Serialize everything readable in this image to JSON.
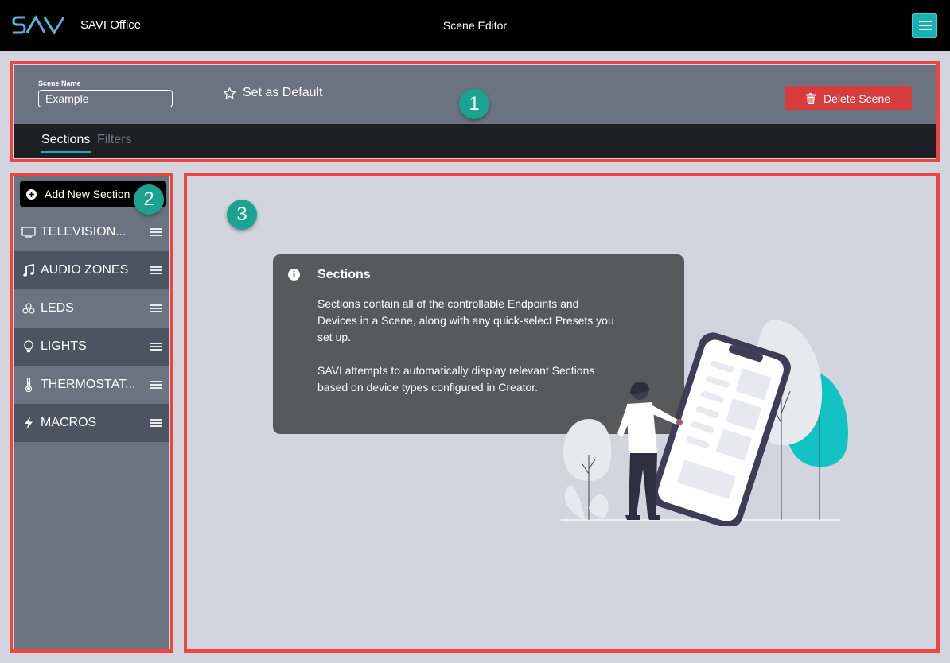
{
  "topbar": {
    "logo_text": "SAVI",
    "app_name": "SAVI Office",
    "page_title": "Scene Editor",
    "menu_icon": "hamburger-icon",
    "accent_color": "#17b1b5"
  },
  "scene": {
    "name_label": "Scene Name",
    "name_value": "Example",
    "set_default_label": "Set as Default",
    "delete_label": "Delete Scene",
    "delete_color": "#d63c3c"
  },
  "tabs": [
    {
      "label": "Sections",
      "active": true
    },
    {
      "label": "Filters",
      "active": false
    }
  ],
  "sidebar": {
    "add_label": "Add New Section",
    "items": [
      {
        "label": "TELEVISION...",
        "icon": "television-icon"
      },
      {
        "label": "AUDIO ZONES",
        "icon": "music-note-icon"
      },
      {
        "label": "LEDS",
        "icon": "leds-icon"
      },
      {
        "label": "LIGHTS",
        "icon": "lightbulb-icon"
      },
      {
        "label": "THERMOSTAT...",
        "icon": "thermometer-icon"
      },
      {
        "label": "MACROS",
        "icon": "lightning-icon"
      }
    ]
  },
  "info": {
    "title": "Sections",
    "p1": "Sections contain all of the controllable Endpoints and Devices in a Scene, along with any quick-select Presets you set up.",
    "p2": "SAVI attempts to automatically display relevant Sections based on device types configured in Creator."
  },
  "badges": [
    "1",
    "2",
    "3"
  ]
}
